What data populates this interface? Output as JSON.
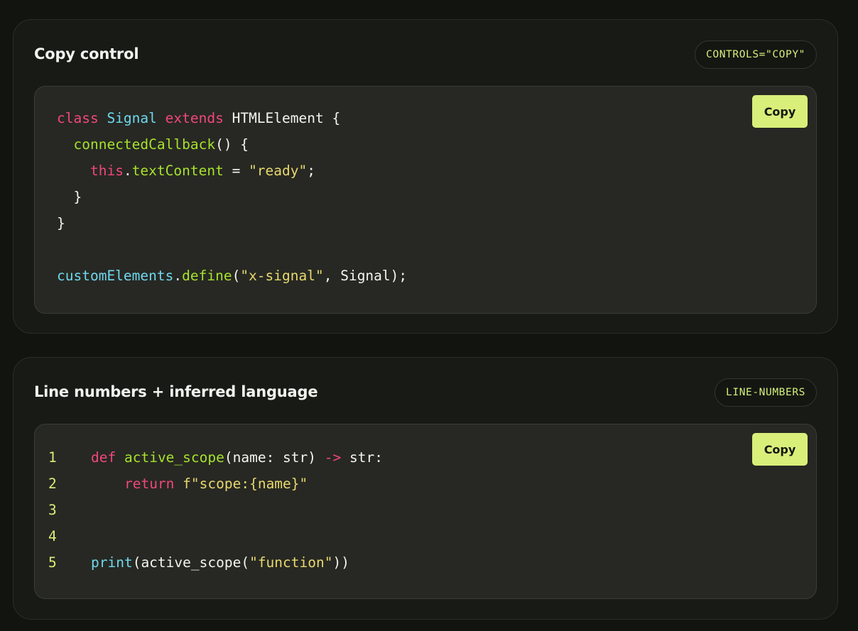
{
  "cards": [
    {
      "title": "Copy control",
      "badge": "CONTROLS=\"COPY\"",
      "copy_label": "Copy",
      "lines": [
        [
          [
            "kw",
            "class"
          ],
          [
            "pl",
            " "
          ],
          [
            "cls",
            "Signal"
          ],
          [
            "pl",
            " "
          ],
          [
            "kw",
            "extends"
          ],
          [
            "pl",
            " HTMLElement {"
          ]
        ],
        [
          [
            "pl",
            "  "
          ],
          [
            "fn",
            "connectedCallback"
          ],
          [
            "pl",
            "() {"
          ]
        ],
        [
          [
            "pl",
            "    "
          ],
          [
            "kw",
            "this"
          ],
          [
            "pl",
            "."
          ],
          [
            "fn",
            "textContent"
          ],
          [
            "pl",
            " = "
          ],
          [
            "str",
            "\"ready\""
          ],
          [
            "pl",
            ";"
          ]
        ],
        [
          [
            "pl",
            "  }"
          ]
        ],
        [
          [
            "pl",
            "}"
          ]
        ],
        [],
        [
          [
            "obj",
            "customElements"
          ],
          [
            "pl",
            "."
          ],
          [
            "fn",
            "define"
          ],
          [
            "pl",
            "("
          ],
          [
            "str",
            "\"x-signal\""
          ],
          [
            "pl",
            ", Signal);"
          ]
        ]
      ]
    },
    {
      "title": "Line numbers + inferred language",
      "badge": "LINE-NUMBERS",
      "copy_label": "Copy",
      "line_numbers": [
        "1",
        "2",
        "3",
        "4",
        "5"
      ],
      "lines": [
        [
          [
            "kw",
            "def"
          ],
          [
            "pl",
            " "
          ],
          [
            "fn",
            "active_scope"
          ],
          [
            "pl",
            "(name: str) "
          ],
          [
            "kw",
            "->"
          ],
          [
            "pl",
            " str:"
          ]
        ],
        [
          [
            "pl",
            "    "
          ],
          [
            "kw",
            "return"
          ],
          [
            "pl",
            " "
          ],
          [
            "str",
            "f\"scope:{name}\""
          ]
        ],
        [],
        [],
        [
          [
            "obj",
            "print"
          ],
          [
            "pl",
            "(active_scope("
          ],
          [
            "str",
            "\"function\""
          ],
          [
            "pl",
            "))"
          ]
        ]
      ]
    }
  ],
  "colors": {
    "accent": "#d8ef7a",
    "keyword": "#f2467c",
    "class": "#6fd8ee",
    "function": "#a7e22d",
    "string": "#e8d86e"
  }
}
